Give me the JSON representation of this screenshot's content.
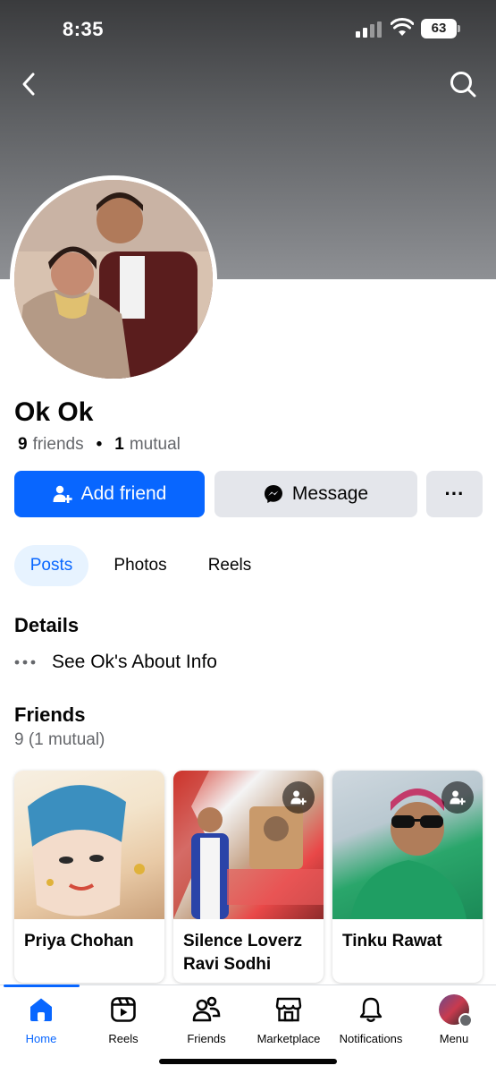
{
  "status_bar": {
    "time": "8:35",
    "battery": "63"
  },
  "profile": {
    "name": "Ok Ok",
    "friends_count": "9",
    "friends_label": "friends",
    "mutual_count": "1",
    "mutual_label": "mutual"
  },
  "actions": {
    "add_friend": "Add friend",
    "message": "Message",
    "more": "···"
  },
  "tabs": [
    {
      "label": "Posts"
    },
    {
      "label": "Photos"
    },
    {
      "label": "Reels"
    }
  ],
  "details": {
    "title": "Details",
    "about_link": "See Ok's About Info"
  },
  "friends": {
    "title": "Friends",
    "count": "9 (1 mutual)",
    "cards": [
      {
        "name": "Priya Chohan"
      },
      {
        "name": "Silence Loverz Ravi Sodhi"
      },
      {
        "name": "Tinku Rawat"
      }
    ]
  },
  "bottom_nav": [
    {
      "label": "Home",
      "icon": "home-icon"
    },
    {
      "label": "Reels",
      "icon": "reels-icon"
    },
    {
      "label": "Friends",
      "icon": "friends-icon"
    },
    {
      "label": "Marketplace",
      "icon": "marketplace-icon"
    },
    {
      "label": "Notifications",
      "icon": "bell-icon"
    },
    {
      "label": "Menu",
      "icon": "menu-avatar-icon"
    }
  ],
  "colors": {
    "accent": "#0866ff",
    "secondary_button": "#e4e6eb",
    "muted_text": "#65676b"
  }
}
